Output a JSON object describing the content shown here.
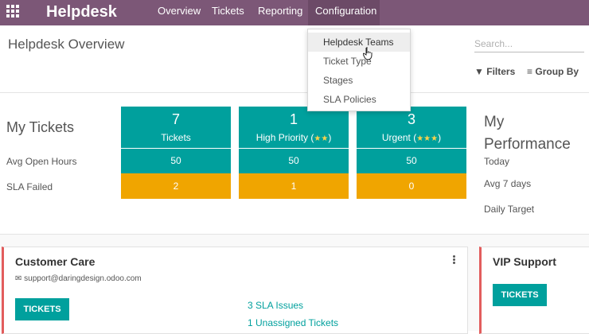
{
  "navbar": {
    "brand": "Helpdesk",
    "items": [
      "Overview",
      "Tickets",
      "Reporting",
      "Configuration"
    ],
    "active": "Configuration"
  },
  "control_panel": {
    "title": "Helpdesk Overview",
    "search_placeholder": "Search...",
    "filters_label": "Filters",
    "groupby_label": "Group By"
  },
  "config_menu": {
    "items": [
      "Helpdesk Teams",
      "Ticket Type",
      "Stages",
      "SLA Policies"
    ],
    "hovered": "Helpdesk Teams"
  },
  "my_tickets": {
    "title": "My Tickets",
    "row_labels": [
      "Avg Open Hours",
      "SLA Failed"
    ],
    "tiles": [
      {
        "count": "7",
        "label": "Tickets",
        "stars": "",
        "avg_open_hours": "50",
        "sla_failed": "2"
      },
      {
        "count": "1",
        "label": "High Priority (",
        "stars": "★★",
        "label_end": ")",
        "avg_open_hours": "50",
        "sla_failed": "1"
      },
      {
        "count": "3",
        "label": "Urgent (",
        "stars": "★★★",
        "label_end": ")",
        "avg_open_hours": "50",
        "sla_failed": "0"
      }
    ]
  },
  "my_performance": {
    "title_line1": "My",
    "title_line2": "Performance",
    "labels": [
      "Today",
      "Avg 7 days",
      "Daily Target"
    ]
  },
  "teams": [
    {
      "name": "Customer Care",
      "email": "support@daringdesign.odoo.com",
      "button": "TICKETS",
      "links": [
        "3 SLA Issues",
        "1 Unassigned Tickets"
      ]
    },
    {
      "name": "VIP Support",
      "button": "TICKETS"
    }
  ],
  "colors": {
    "navbar": "#7c5777",
    "teal": "#00a09d",
    "orange": "#f0a500",
    "card_accent": "#e25d5d"
  }
}
